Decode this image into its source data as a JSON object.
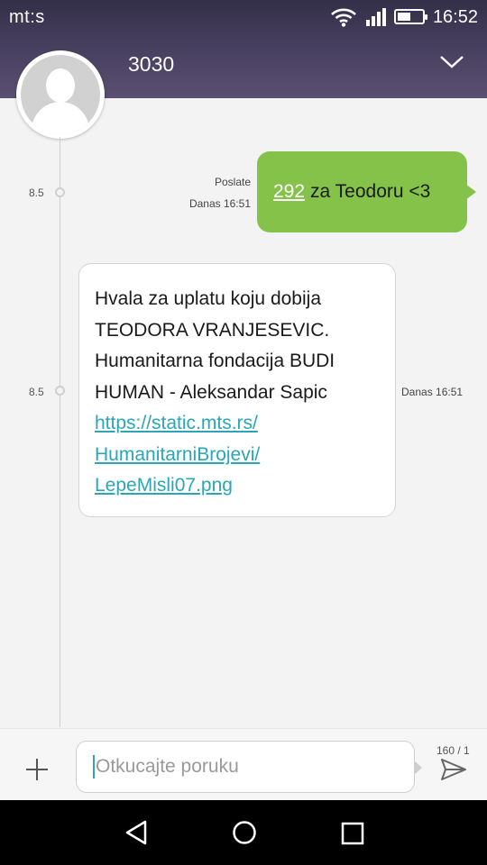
{
  "status_bar": {
    "carrier": "mt:s",
    "time": "16:52",
    "battery_level": 0.55
  },
  "header": {
    "contact_name": "3030",
    "expand_icon": "chevron-down-icon"
  },
  "messages": [
    {
      "direction": "sent",
      "day_label": "8.5",
      "status": "Poslate",
      "time": "Danas 16:51",
      "number_link": "292",
      "text": "za Teodoru <3"
    },
    {
      "direction": "received",
      "day_label": "8.5",
      "time": "Danas 16:51",
      "lines": [
        "Hvala za uplatu koju dobija",
        "TEODORA VRANJESEVIC.",
        "Humanitarna fondacija BUDI",
        "HUMAN - Aleksandar Sapic"
      ],
      "link_lines": [
        "https://static.mts.rs/",
        "HumanitarniBrojevi/",
        "LepeMisli07.png"
      ]
    }
  ],
  "composer": {
    "placeholder": "Otkucajte poruku",
    "counter": "160 / 1"
  },
  "colors": {
    "header": "#4a4262",
    "sent_bubble": "#84c24a",
    "link": "#2aa6b8"
  }
}
